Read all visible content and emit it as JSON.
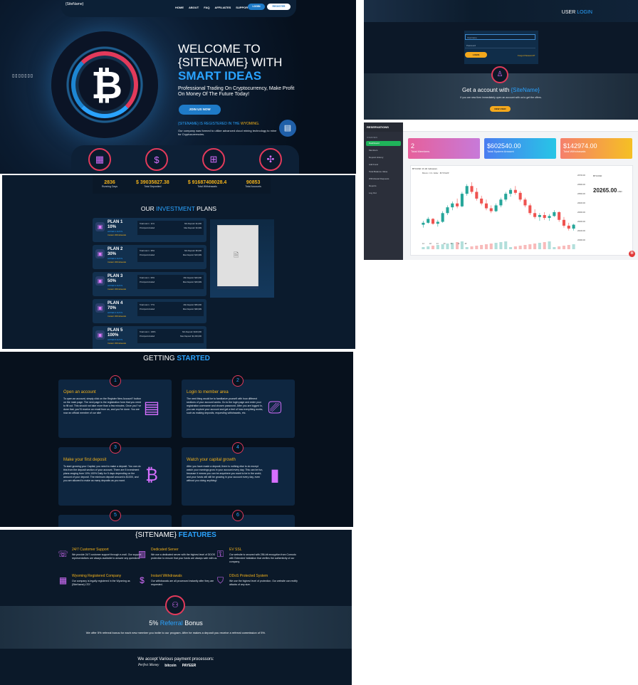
{
  "hero": {
    "logo": "{SiteName}",
    "nav": [
      "HOME",
      "ABOUT",
      "FAQ",
      "AFFILIATES",
      "SUPPORT"
    ],
    "login": "LOGIN",
    "register": "REGISTER",
    "title_line1": "WELCOME TO",
    "title_line2": "{SITENAME} WITH",
    "title_line3": "SMART IDEAS",
    "subtitle": "Professional Trading On Cryptocurrency, Make Profit On Money Of The Future Today!",
    "cta": "JOIN US NOW",
    "registered_prefix": "{SITENAME} IS REGISTERED IN THE ",
    "registered_place": "WYOMING.",
    "description": "Our company was formed to utilize advanced cloud mining technology to mine for Cryptocurrencies.",
    "left_text": "▯▯▯▯▯▯▯",
    "accent": "#2aa3ff"
  },
  "login_panel": {
    "title_prefix": "USER ",
    "title_accent": "LOGIN",
    "username_placeholder": "Username",
    "password_placeholder": "Password",
    "login_button": "LOGIN",
    "forgot": "Forgot Password?",
    "headline_prefix": "Get a account with ",
    "headline_accent": "{SiteName}",
    "headline_sub": "If you are new then immediately open an account with us to get the offers.",
    "new_button": "NEW USER"
  },
  "dashboard": {
    "brand": "RESERVATIONS",
    "section": "OVERVIEW",
    "sidebar": [
      "Dashboard",
      "Members",
      "Deposit History",
      "Add Fund",
      "Total Balance Value",
      "Withdrawal Requests",
      "Reports",
      "Log Out"
    ],
    "cards": [
      {
        "value": "2",
        "label": "Total Members",
        "color": "#e6609b"
      },
      {
        "value": "$602540.00",
        "label": "Total System Amount",
        "color": "#27b3e6"
      },
      {
        "value": "$142974.00",
        "label": "Total Withdrawals",
        "color": "#f5a623"
      }
    ],
    "chart_symbol": "BTCUSD",
    "chart_toolbar": "1h  1D  Indicators",
    "chart_info": "Bitcoin / U.S. Dollar · BITSTAMP",
    "price": "20265.00",
    "price_unit": "USD",
    "y_ticks": [
      "20700.00",
      "20600.00",
      "20500.00",
      "20400.00",
      "20300.00",
      "20200.00",
      "20100.00",
      "20000.00"
    ],
    "x_ticks": [
      "12",
      "18",
      "24",
      "30",
      "06",
      "12",
      "18"
    ]
  },
  "stats": [
    {
      "value": "2836",
      "label": "Running Days"
    },
    {
      "value": "$ 39035827.38",
      "label": "Total Deposited"
    },
    {
      "value": "$ 91687408028.4",
      "label": "Total Withdrawals"
    },
    {
      "value": "90853",
      "label": "Total Accounts"
    }
  ],
  "plans_heading_prefix": "OUR ",
  "plans_heading_accent": "INVESTMENT",
  "plans_heading_suffix": " PLANS",
  "plans": [
    {
      "name": "PLAN 1",
      "pct": "10%",
      "days": "AFTER 1 DAYS",
      "wd": "Instant Withdrawals",
      "ret": "Total return : 11%",
      "min": "Min Deposit: $1,000",
      "prin": "Principal included",
      "max": "Max Deposit: $4,999"
    },
    {
      "name": "PLAN 2",
      "pct": "30%",
      "days": "AFTER 2 DAYS",
      "wd": "Instant Withdrawals",
      "ret": "Total return : 35%",
      "min": "Min Deposit: $5,000",
      "prin": "Principal included",
      "max": "Max Deposit: $19,999"
    },
    {
      "name": "PLAN 3",
      "pct": "50%",
      "days": "AFTER 3 DAYS",
      "wd": "Instant Withdrawals",
      "ret": "Total return : 60%",
      "min": "Min Deposit: $20,000",
      "prin": "Principal included",
      "max": "Max Deposit: $49,999"
    },
    {
      "name": "PLAN 4",
      "pct": "70%",
      "days": "AFTER 4 DAYS",
      "wd": "Instant Withdrawals",
      "ret": "Total return : 77%",
      "min": "Min Deposit: $50,000",
      "prin": "Principal included",
      "max": "Max Deposit: $99,999"
    },
    {
      "name": "PLAN 5",
      "pct": "100%",
      "days": "AFTER 5 DAYS",
      "wd": "Instant Withdrawals",
      "ret": "Total return : 100%",
      "min": "Min Deposit: $100,000",
      "prin": "Principal included",
      "max": "Max Deposit: $1,000,000"
    }
  ],
  "getting_started": {
    "prefix": "GETTING ",
    "accent": "STARTED",
    "steps": [
      {
        "num": "1",
        "title": "Open an account",
        "text": "To open an account, simply click on the Register New Account? button on the main page. The next page is the registration form that you need to fill out. This should not take more than a few minutes. Once you? ve done that, you?ll receive an email from us, and you?re done. You are now an official member of our site!"
      },
      {
        "num": "2",
        "title": "Login to member area",
        "text": "The next thing would be to familiarize yourself with how different sections of your account works. Go to the login page and enter your registration username and chosen password. After you are logged in, you can explore your account and get a feel of how everything works, such as making deposits, requesting withdrawals, etc."
      },
      {
        "num": "3",
        "title": "Make your first deposit",
        "text": "To start growing your Capital, you need to make a deposit. You can do this from the deposit section of your account. There are 5 investment plans ranging from 10%-100% Daily for 5 days depending on the amount of your deposit. The minimum deposit amount is $1000, and you are allowed to make as many deposits as you want."
      },
      {
        "num": "4",
        "title": "Watch your capital growth",
        "text": "After you have made a deposit, there is nothing else to do except watch your earnings grow in your account every day. This can be fun, because it means you can be anywhere you want to be in the world, and your funds will still be growing in your account every day, even without you doing anything!"
      },
      {
        "num": "5",
        "title": "",
        "text": ""
      },
      {
        "num": "6",
        "title": "",
        "text": ""
      }
    ]
  },
  "features": {
    "prefix": "{SITENAME} ",
    "accent": "FEATURES",
    "items": [
      {
        "title": "24/7 Customer Support",
        "text": "We provide 24/7 customer support through e-mail. Our support representatives are always available to answer any questions."
      },
      {
        "title": "Dedicated Server",
        "text": "We use a dedicated server with the highest level of DDOS protection to ensure that your funds are always safe with us."
      },
      {
        "title": "EV SSL",
        "text": "Our website is secured with 256-bit encryption from Comodo with Extended Validation that verifies the authenticity of our company."
      },
      {
        "title": "Wyoming Registered Company",
        "text": "Our company is legally registered in the Wyoming as {SiteName} LTD\"."
      },
      {
        "title": "Instant Withdrawals",
        "text": "Our withdrawals are all processed instantly after they are requested."
      },
      {
        "title": "DDoS Protected System",
        "text": "We use the highest level of protection. Our website can rectify attacks of any size."
      }
    ],
    "referral_prefix": "5% ",
    "referral_accent": "Referral",
    "referral_suffix": " Bonus",
    "referral_text": "We offer 5% referral bonus for each new member you invite to our program. After he makes a deposit you receive a referral commission of 5%.",
    "payments_title": "We accept Various payment processors:",
    "payments": [
      "Perfect Money",
      "bitcoin",
      "PAYEER"
    ]
  },
  "chart_data": {
    "type": "candlestick",
    "symbol": "BTCUSD",
    "ylim": [
      20000,
      20700
    ],
    "candles": [
      [
        20180,
        20220,
        20150,
        20200
      ],
      [
        20200,
        20260,
        20190,
        20240
      ],
      [
        20240,
        20250,
        20180,
        20190
      ],
      [
        20190,
        20230,
        20160,
        20210
      ],
      [
        20210,
        20320,
        20200,
        20300
      ],
      [
        20300,
        20380,
        20280,
        20360
      ],
      [
        20360,
        20420,
        20330,
        20400
      ],
      [
        20400,
        20450,
        20350,
        20370
      ],
      [
        20370,
        20520,
        20360,
        20500
      ],
      [
        20500,
        20600,
        20480,
        20580
      ],
      [
        20580,
        20620,
        20500,
        20520
      ],
      [
        20520,
        20560,
        20430,
        20450
      ],
      [
        20450,
        20480,
        20380,
        20400
      ],
      [
        20400,
        20440,
        20330,
        20350
      ],
      [
        20350,
        20380,
        20300,
        20320
      ],
      [
        20320,
        20400,
        20310,
        20380
      ],
      [
        20380,
        20460,
        20360,
        20440
      ],
      [
        20440,
        20520,
        20420,
        20500
      ],
      [
        20500,
        20560,
        20470,
        20540
      ],
      [
        20540,
        20580,
        20490,
        20510
      ],
      [
        20510,
        20530,
        20420,
        20440
      ],
      [
        20440,
        20460,
        20360,
        20380
      ],
      [
        20380,
        20400,
        20280,
        20300
      ],
      [
        20300,
        20340,
        20240,
        20260
      ],
      [
        20260,
        20300,
        20220,
        20280
      ],
      [
        20280,
        20310,
        20230,
        20250
      ],
      [
        20250,
        20290,
        20220,
        20270
      ],
      [
        20270,
        20330,
        20260,
        20310
      ],
      [
        20310,
        20320,
        20210,
        20230
      ],
      [
        20230,
        20260,
        20150,
        20170
      ],
      [
        20170,
        20200,
        20120,
        20140
      ],
      [
        20140,
        20190,
        20120,
        20180
      ]
    ]
  }
}
